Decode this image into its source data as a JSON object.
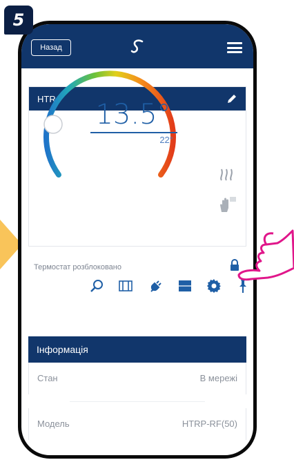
{
  "step_number": "5",
  "header": {
    "back_label": "Назад",
    "logo_icon": "salus-logo-icon",
    "menu_icon": "hamburger-menu-icon"
  },
  "device": {
    "name": "HTR",
    "edit_icon": "pencil-icon",
    "current_temp": "13.5°",
    "set_temp": "22°",
    "heating_icon": "heat-waves-icon",
    "manual_icon": "hand-manual-icon",
    "lock_status": "Термостат розблоковано",
    "lock_icon": "padlock-icon",
    "toolbar_icons": [
      "search-icon",
      "window-icon",
      "plug-icon",
      "floor-heating-icon",
      "gear-icon",
      "pin-icon"
    ]
  },
  "info": {
    "title": "Інформація",
    "rows": [
      {
        "label": "Стан",
        "value": "В мережі"
      },
      {
        "label": "Модель",
        "value": "HTRP-RF(50)"
      }
    ]
  },
  "colors": {
    "brand_navy": "#11366b",
    "accent_blue": "#1f5fa6",
    "arrow_yellow": "#f9c45a",
    "finger_magenta": "#e0168a"
  }
}
